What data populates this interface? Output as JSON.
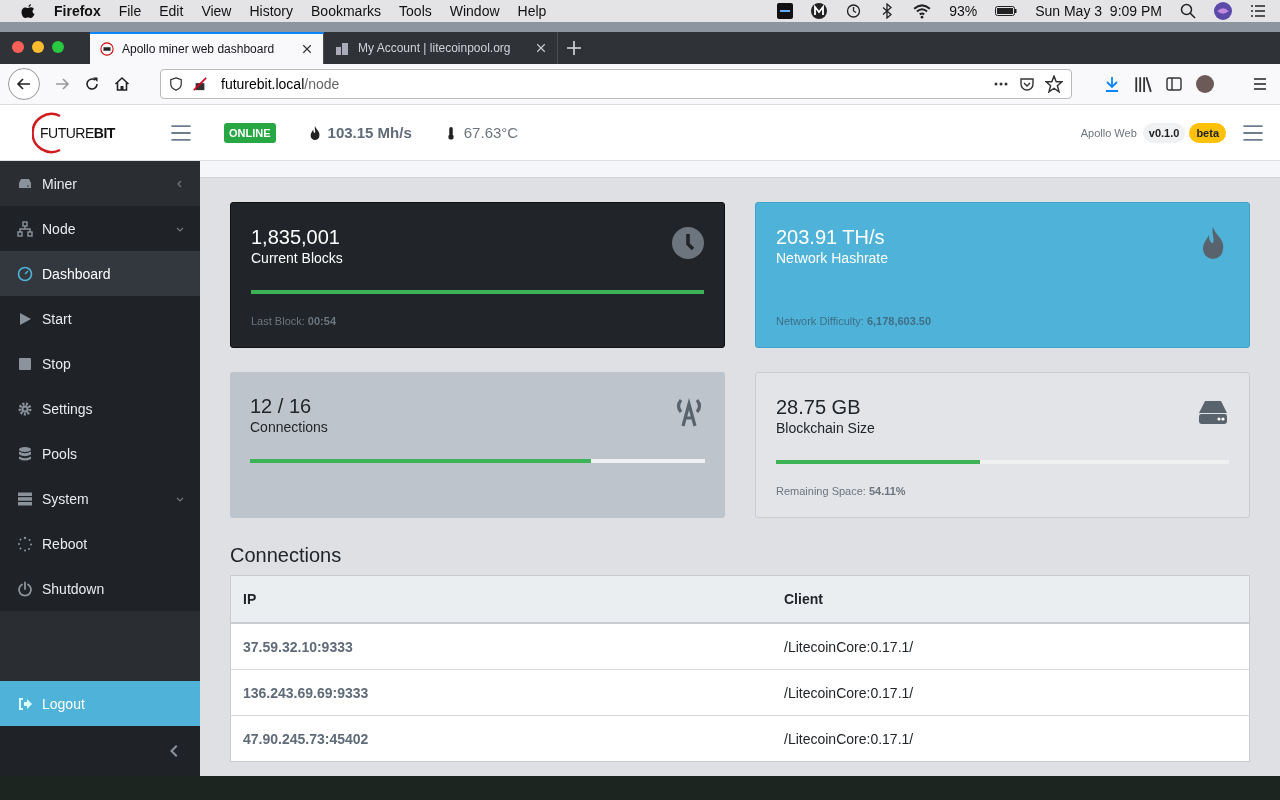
{
  "menubar": {
    "app": "Firefox",
    "menus": [
      "File",
      "Edit",
      "View",
      "History",
      "Bookmarks",
      "Tools",
      "Window",
      "Help"
    ],
    "battery": "93%",
    "clock": "Sun May 3  9:09 PM"
  },
  "browser": {
    "tabs": [
      {
        "title": "Apollo miner web dashboard",
        "selected": true
      },
      {
        "title": "My Account | litecoinpool.org",
        "selected": false
      }
    ],
    "url_host": "futurebit.local",
    "url_path": "/node"
  },
  "header": {
    "logo_light": "FUTURE",
    "logo_bold": "BIT",
    "status": "ONLINE",
    "hashrate": "103.15 Mh/s",
    "temperature": "67.63°C",
    "app_name": "Apollo Web",
    "version": "v0.1.0",
    "channel": "beta"
  },
  "sidebar": {
    "items": [
      {
        "label": "Miner",
        "expanded": false,
        "selected": false
      },
      {
        "label": "Node",
        "expanded": true,
        "selected": false,
        "children": [
          {
            "label": "Dashboard",
            "selected": true
          },
          {
            "label": "Start",
            "selected": false
          },
          {
            "label": "Stop",
            "selected": false
          },
          {
            "label": "Settings",
            "selected": false
          },
          {
            "label": "Pools",
            "selected": false
          }
        ]
      },
      {
        "label": "System",
        "expanded": true,
        "selected": false,
        "children": [
          {
            "label": "Reboot",
            "selected": false
          },
          {
            "label": "Shutdown",
            "selected": false
          }
        ]
      }
    ],
    "logout": "Logout"
  },
  "cards": [
    {
      "kind": "blocks",
      "value": "1,835,001",
      "label": "Current Blocks",
      "level": 1,
      "footer": "Last Block: **00:54**"
    },
    {
      "kind": "hashrate",
      "value": "203.91 TH/s",
      "label": "Network Hashrate",
      "footer": "Network Difficulty: **6,178,603.50**"
    },
    {
      "kind": "connections",
      "value": "12 / 16",
      "label": "Connections",
      "level": 0.75
    },
    {
      "kind": "storage",
      "value": "28.75 GB",
      "label": "Blockchain Size",
      "level": 0.45,
      "footer": "Remaining Space: **54.11%**"
    }
  ],
  "connections": {
    "title": "Connections",
    "columns": [
      "IP",
      "Client"
    ],
    "rows": [
      [
        "37.59.32.10:9333",
        "/LitecoinCore:0.17.1/"
      ],
      [
        "136.243.69.69:9333",
        "/LitecoinCore:0.17.1/"
      ],
      [
        "47.90.245.73:45402",
        "/LitecoinCore:0.17.1/"
      ]
    ]
  }
}
